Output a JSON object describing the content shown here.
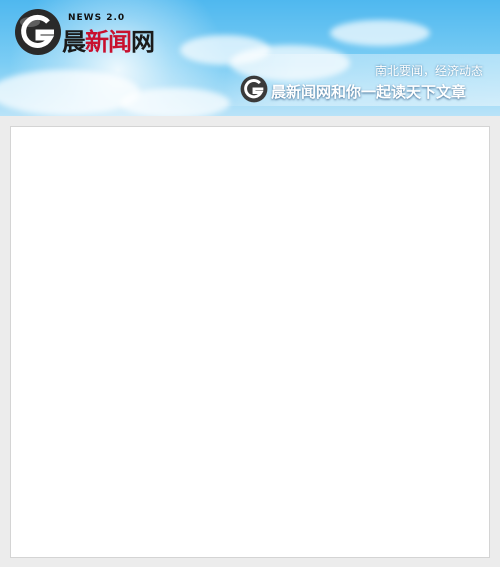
{
  "header": {
    "logo_news": "NEWS 2.0",
    "logo_chars": [
      "晨",
      "新闻",
      "网"
    ],
    "tagline_top": "南北要闻，经济动态",
    "tagline_main": "晨新闻网和你一起读天下文章"
  },
  "colors": {
    "sky": "#4fb8ef",
    "brand_red": "#c8102e",
    "page_bg": "#ececec"
  },
  "content": {
    "body_text": ""
  }
}
